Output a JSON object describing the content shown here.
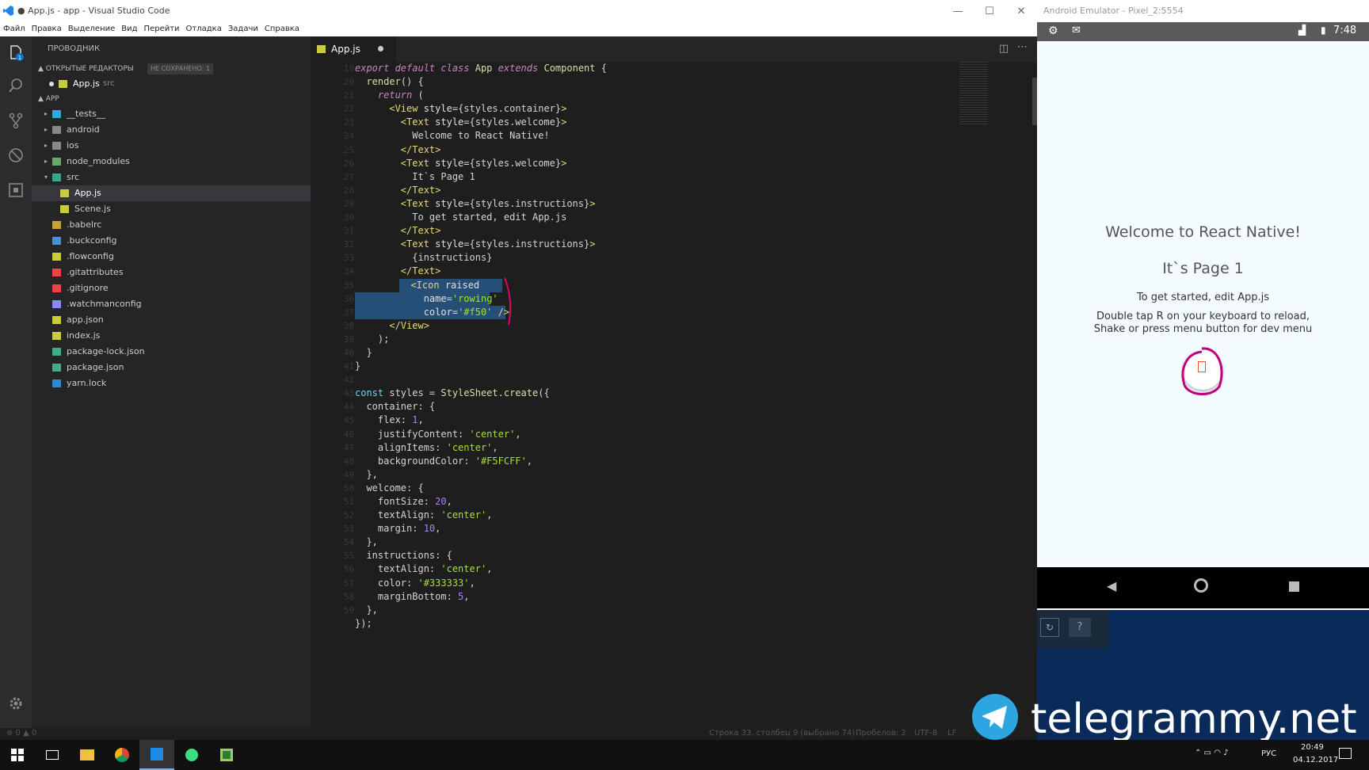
{
  "vscode": {
    "title": "● App.js - app - Visual Studio Code",
    "menu": [
      "Файл",
      "Правка",
      "Выделение",
      "Вид",
      "Перейти",
      "Отладка",
      "Задачи",
      "Справка"
    ],
    "explorer": {
      "title": "ПРОВОДНИК",
      "open_editors": "▲ ОТКРЫТЫЕ РЕДАКТОРЫ",
      "unsaved": "НЕ СОХРАНЕНО: 1",
      "open_file": "App.js",
      "open_file_dir": "src",
      "project": "▲ APP",
      "tree": [
        "__tests__",
        "android",
        "ios",
        "node_modules",
        "src",
        "App.js",
        "Scene.js",
        ".babelrc",
        ".buckconfig",
        ".flowconfig",
        ".gitattributes",
        ".gitignore",
        ".watchmanconfig",
        "app.json",
        "index.js",
        "package-lock.json",
        "package.json",
        "yarn.lock"
      ]
    },
    "tab": "App.js",
    "status": {
      "problems": "⊗ 0 ▲ 0",
      "position": "Строка 33, столбец 9 (выбрано 74)",
      "spaces": "Пробелов: 2",
      "encoding": "UTF-8",
      "eol": "LF"
    }
  },
  "emulator": {
    "title": "Android Emulator - Pixel_2:5554",
    "time": "7:48",
    "welcome": "Welcome to React Native!",
    "page": "It`s Page 1",
    "start": "To get started, edit App.js",
    "reload1": "Double tap R on your keyboard to reload,",
    "reload2": "Shake or press menu button for dev menu",
    "icon_color": "#f50"
  },
  "taskbar": {
    "lang": "РУС",
    "time": "20:49",
    "date": "04.12.2017"
  },
  "watermark": "telegrammy.net"
}
